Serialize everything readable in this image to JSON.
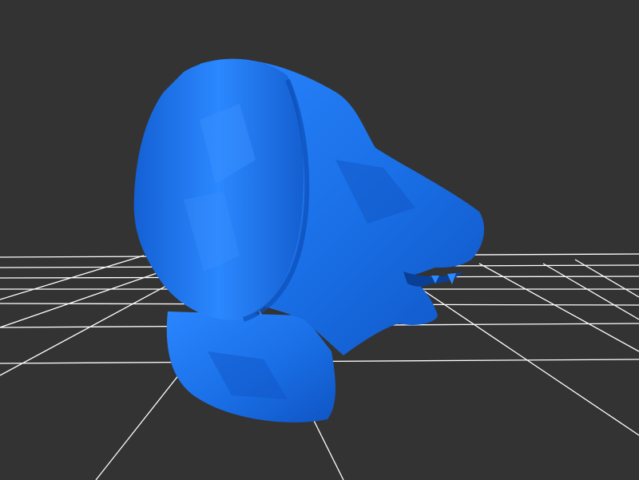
{
  "scene": {
    "background_color": "#333333",
    "grid_color": "#ffffff",
    "model": {
      "name": "lion-head",
      "color": "#1a6fe6",
      "shade_color": "#0f55c4",
      "highlight_color": "#3c92ff"
    }
  }
}
